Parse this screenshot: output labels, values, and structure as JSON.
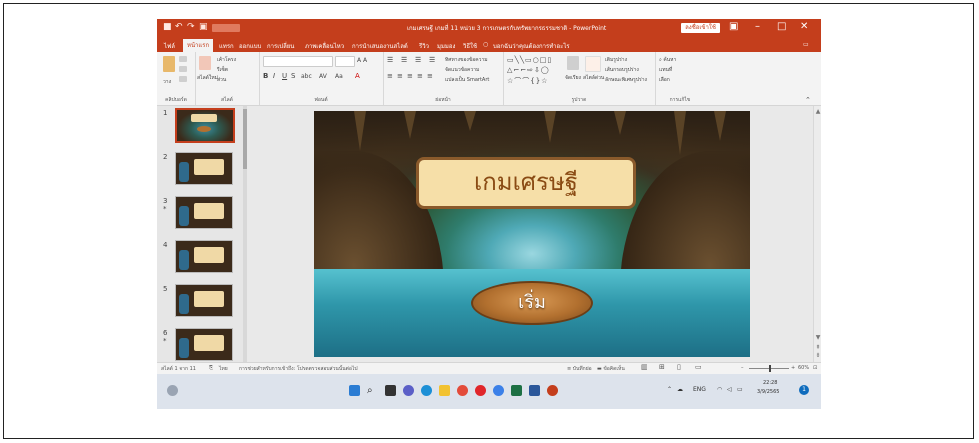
{
  "window": {
    "title": "เกมเศรษฐี เกมที่ 11 หน่วย 3 การเกษตรกับทรัพยากรธรรมชาติ  -  PowerPoint",
    "signin_label": "ลงชื่อเข้าใช้",
    "qa_icons": [
      "save-icon",
      "undo-icon",
      "redo-icon",
      "present-icon"
    ]
  },
  "tabs": [
    "ไฟล์",
    "หน้าแรก",
    "แทรก",
    "ออกแบบ",
    "การเปลี่ยน",
    "ภาพเคลื่อนไหว",
    "การนำเสนองานสไลด์",
    "รีวิว",
    "มุมมอง",
    "วิธีใช้",
    "บอกฉันว่าคุณต้องการทำอะไร"
  ],
  "active_tab": "หน้าแรก",
  "ribbon": {
    "groups": [
      "คลิปบอร์ด",
      "สไลด์",
      "ฟอนต์",
      "ย่อหน้า",
      "รูปวาด",
      "การแก้ไข"
    ],
    "paste_label": "วาง",
    "new_slide_label": "สไลด์ใหม่",
    "layout_label": "เค้าโครง",
    "reset_label": "รีเซ็ต",
    "section_label": "ส่วน",
    "find_label": "ค้นหา",
    "replace_label": "แทนที่",
    "select_label": "เลือก",
    "arrange_label": "จัดเรียง",
    "text_direction_label": "ทิศทางของข้อความ",
    "align_text_label": "จัดแนวข้อความ",
    "smartart_label": "แปลงเป็น SmartArt",
    "shape_fill_label": "เติมรูปร่าง",
    "shape_outline_label": "เส้นกรอบรูปร่าง",
    "shape_effects_label": "ลักษณะพิเศษรูปร่าง",
    "quick_styles_label": "สไตล์ด่วน"
  },
  "thumbnails": [
    {
      "num": "1",
      "star": false,
      "selected": true
    },
    {
      "num": "2",
      "star": false,
      "selected": false
    },
    {
      "num": "3",
      "star": true,
      "selected": false
    },
    {
      "num": "4",
      "star": false,
      "selected": false
    },
    {
      "num": "5",
      "star": false,
      "selected": false
    },
    {
      "num": "6",
      "star": true,
      "selected": false
    }
  ],
  "slide": {
    "title_text": "เกมเศรษฐี",
    "start_button": "เริ่ม"
  },
  "status_bar": {
    "slide_info": "สไลด์ 1 จาก 11",
    "language": "ไทย",
    "accessibility": "การช่วยสำหรับการเข้าถึง: โปรดตรวจสอบส่วนนั้นต่อไป",
    "notes_label": "บันทึกย่อ",
    "comments_label": "ข้อคิดเห็น",
    "zoom": "60%"
  },
  "taskbar": {
    "lang": "ENG",
    "time": "22:28",
    "date": "3/9/2565",
    "notif_count": "1",
    "icons": [
      "start-icon",
      "search-icon",
      "task-view-icon",
      "chat-icon",
      "edge-icon",
      "file-explorer-icon",
      "chrome-icon",
      "opera-icon",
      "chrome-alt-icon",
      "excel-icon",
      "word-icon",
      "powerpoint-icon"
    ]
  }
}
